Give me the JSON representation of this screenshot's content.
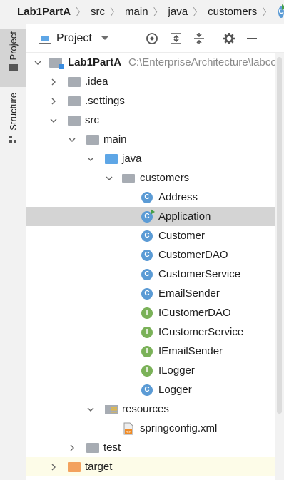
{
  "breadcrumb": {
    "items": [
      "Lab1PartA",
      "src",
      "main",
      "java",
      "customers"
    ],
    "separator": "〉"
  },
  "side_tabs": {
    "project": "Project",
    "structure": "Structure"
  },
  "panel": {
    "view": "Project"
  },
  "tree": {
    "project_name": "Lab1PartA",
    "project_path": "C:\\EnterpriseArchitecture\\labco",
    "idea": ".idea",
    "settings": ".settings",
    "src": "src",
    "main": "main",
    "java": "java",
    "customers": "customers",
    "classes": [
      "Address",
      "Application",
      "Customer",
      "CustomerDAO",
      "CustomerService",
      "EmailSender",
      "ICustomerDAO",
      "ICustomerService",
      "IEmailSender",
      "ILogger",
      "Logger"
    ],
    "resources": "resources",
    "springconfig": "springconfig.xml",
    "test": "test",
    "target": "target"
  },
  "colors": {
    "class_icon": "#5b9bd5",
    "interface_icon": "#7ab158",
    "selection": "#d4d4d4",
    "target_row": "#fdfce8"
  }
}
